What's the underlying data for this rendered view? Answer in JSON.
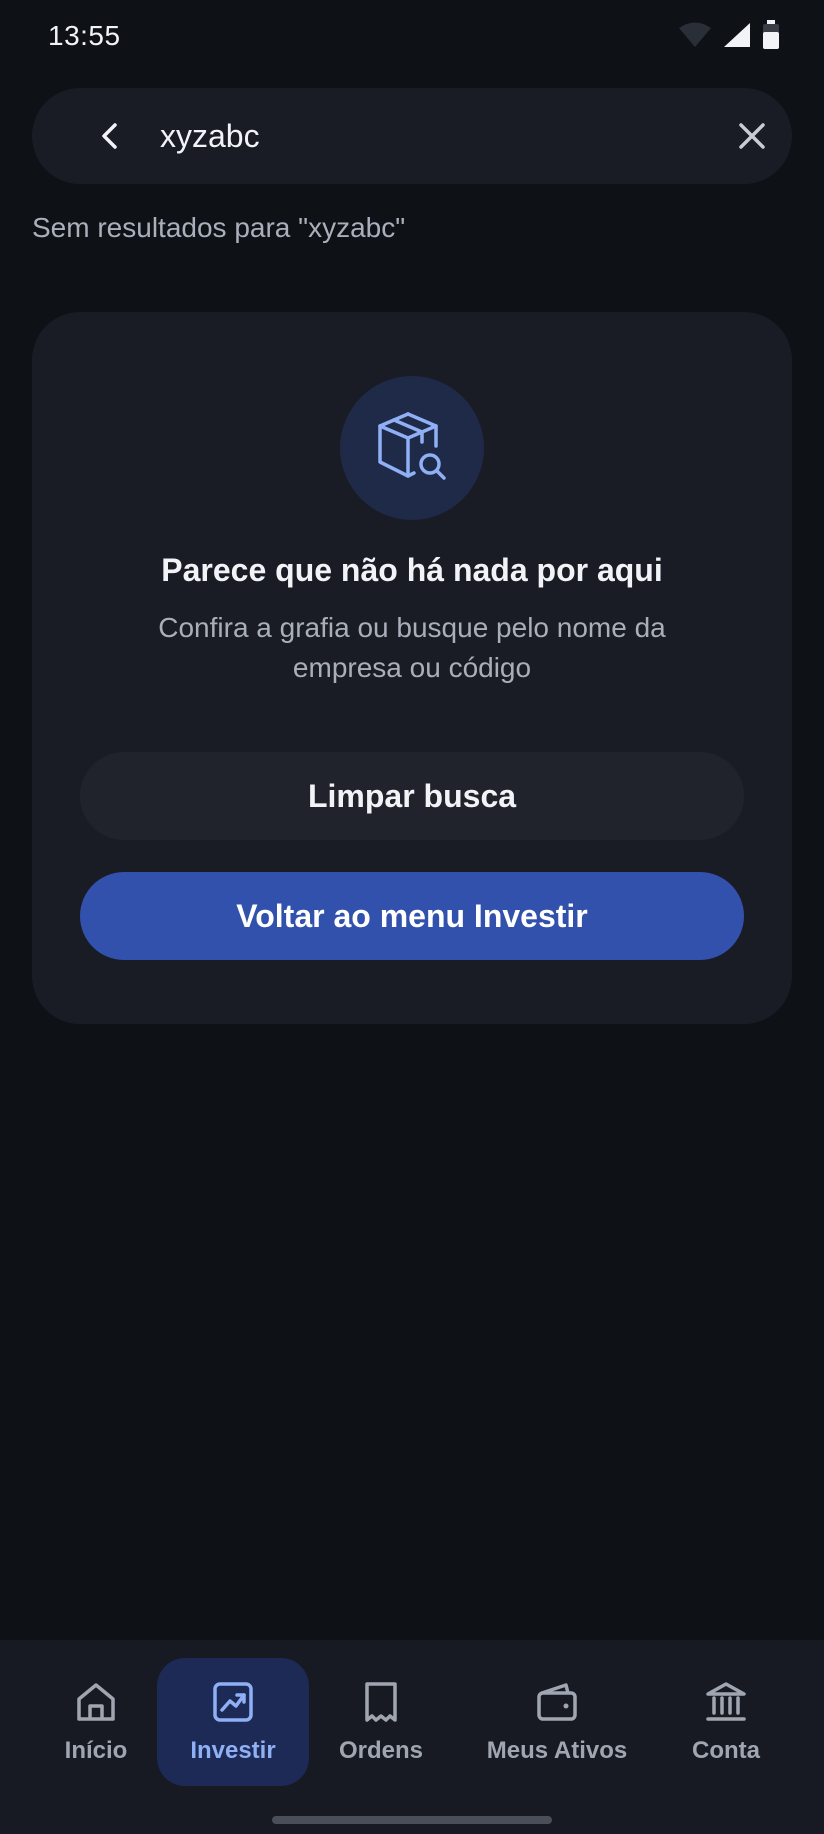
{
  "status_bar": {
    "time": "13:55"
  },
  "search": {
    "value": "xyzabc",
    "no_results_text": "Sem resultados para \"xyzabc\""
  },
  "empty_state": {
    "title": "Parece que não há nada por aqui",
    "subtitle": "Confira a grafia ou busque pelo nome da empresa ou código",
    "icon": "box-search-icon",
    "clear_button_label": "Limpar busca",
    "back_button_label": "Voltar ao menu Investir"
  },
  "bottom_nav": {
    "items": [
      {
        "label": "Início",
        "icon": "home-icon",
        "active": false
      },
      {
        "label": "Investir",
        "icon": "chart-up-icon",
        "active": true
      },
      {
        "label": "Ordens",
        "icon": "receipt-icon",
        "active": false
      },
      {
        "label": "Meus Ativos",
        "icon": "wallet-icon",
        "active": false
      },
      {
        "label": "Conta",
        "icon": "bank-icon",
        "active": false
      }
    ]
  },
  "colors": {
    "background": "#0e1116",
    "card": "#191c24",
    "primary": "#3151ac",
    "active_nav_bg": "#1c2a55",
    "active_nav_text": "#8fb0f5"
  }
}
